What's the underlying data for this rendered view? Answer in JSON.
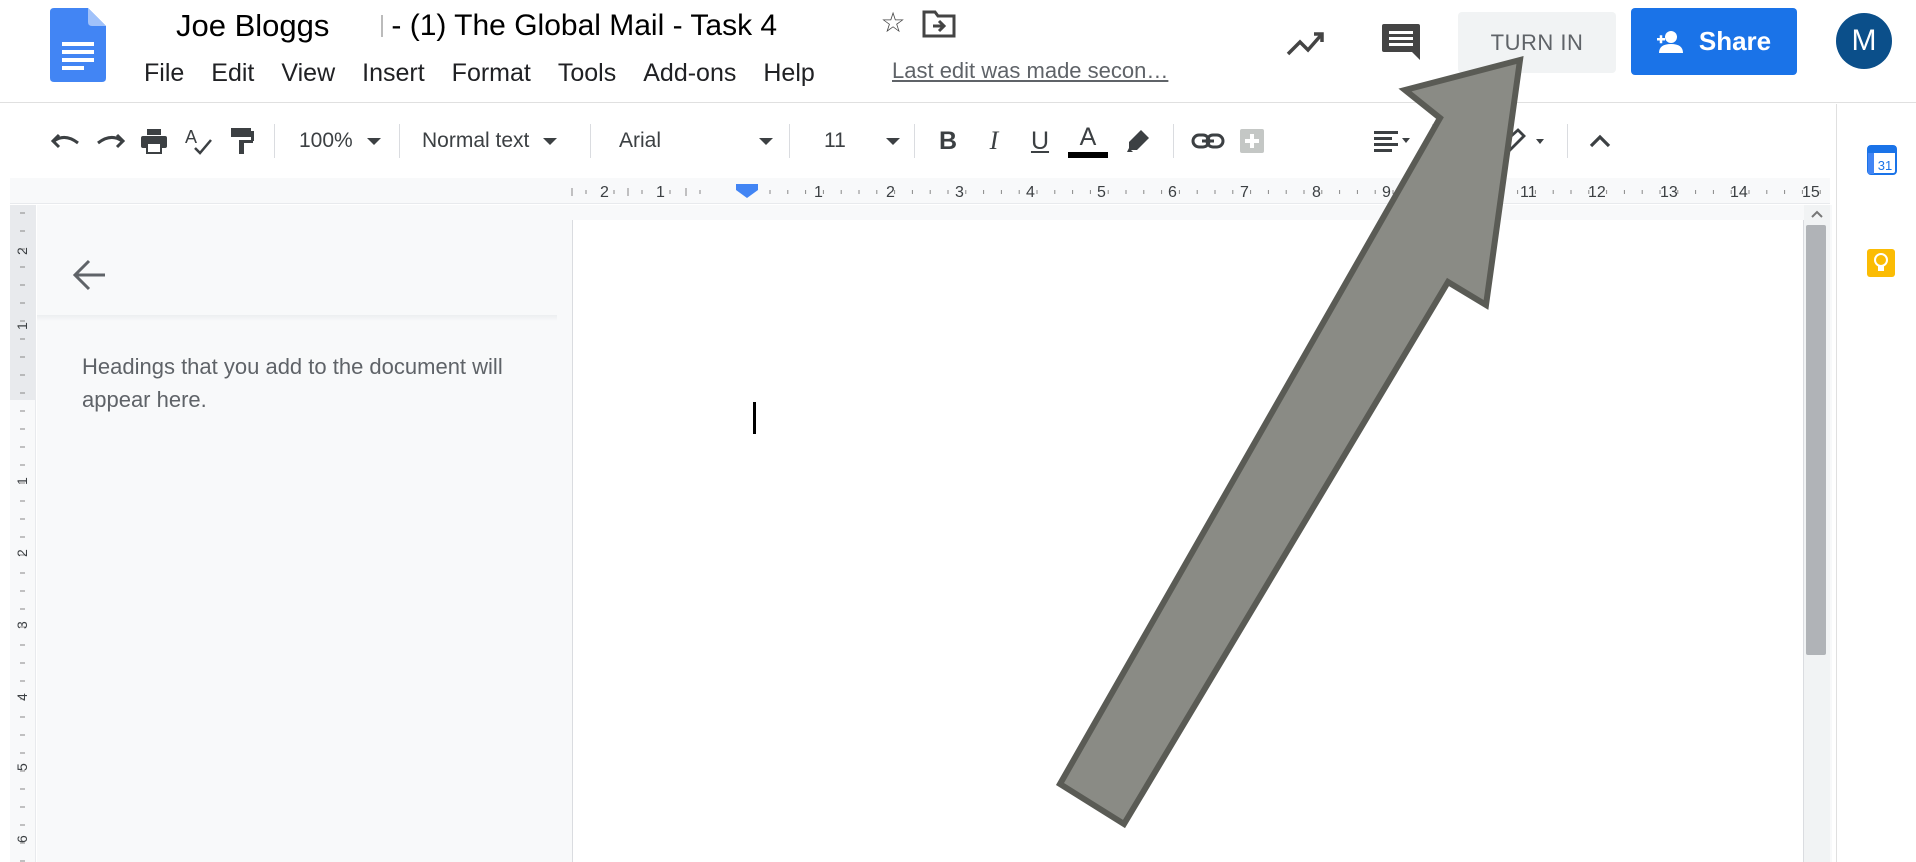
{
  "document": {
    "owner_name": "Joe Bloggs",
    "title_rest": "- (1) The Global Mail - Task 4"
  },
  "menu": {
    "items": [
      "File",
      "Edit",
      "View",
      "Insert",
      "Format",
      "Tools",
      "Add-ons",
      "Help"
    ],
    "last_edit": "Last edit was made secon…"
  },
  "header": {
    "turn_in_label": "TURN IN",
    "share_label": "Share",
    "avatar_initial": "M"
  },
  "toolbar": {
    "zoom": "100%",
    "style": "Normal text",
    "font": "Arial",
    "font_size": "11",
    "bold": "B",
    "italic": "I",
    "underline": "U",
    "text_color_letter": "A",
    "more": "···"
  },
  "ruler": {
    "ticks": [
      "2",
      "1",
      "1",
      "2",
      "3",
      "4",
      "5",
      "6",
      "7",
      "8",
      "9",
      "11",
      "12",
      "13",
      "14",
      "15"
    ]
  },
  "vertical_ruler": {
    "ticks": [
      "2",
      "1",
      "1",
      "2",
      "3",
      "4",
      "5",
      "6"
    ]
  },
  "outline": {
    "hint": "Headings that you add to the document will appear here."
  },
  "side_panel": {
    "calendar_date": "31"
  },
  "colors": {
    "docs_blue": "#4285f4",
    "share_blue": "#1a73e8",
    "avatar": "#0b4f8a",
    "keep_yellow": "#fbbc04",
    "annotation_arrow": "#8a8b85"
  }
}
